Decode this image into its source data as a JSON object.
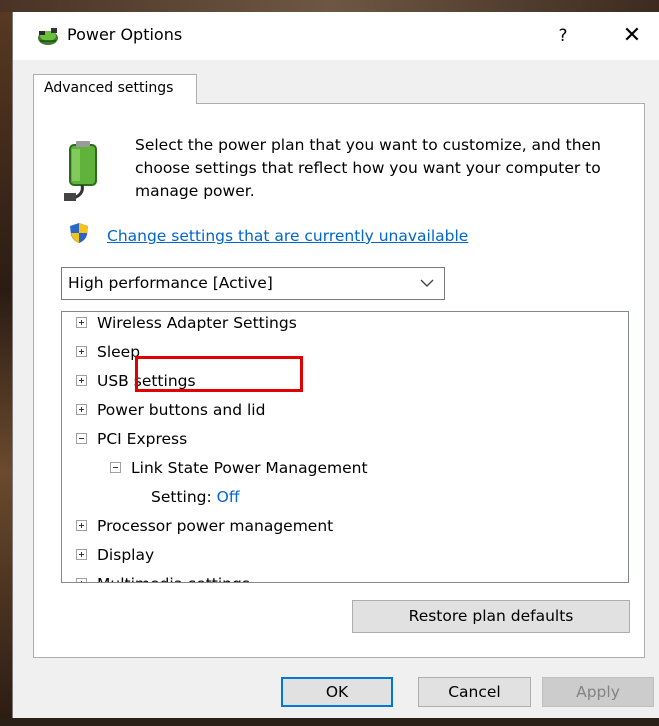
{
  "window": {
    "title": "Power Options",
    "help_label": "?",
    "close_label": "✕",
    "tab_label": "Advanced settings"
  },
  "panel": {
    "description": "Select the power plan that you want to customize, and then choose settings that reflect how you want your computer to manage power.",
    "change_link": "Change settings that are currently unavailable",
    "plan_selected": "High performance [Active]"
  },
  "tree": {
    "items": [
      {
        "label": "Wireless Adapter Settings",
        "expanded": false
      },
      {
        "label": "Sleep",
        "expanded": false
      },
      {
        "label": "USB settings",
        "expanded": false
      },
      {
        "label": "Power buttons and lid",
        "expanded": false
      },
      {
        "label": "PCI Express",
        "expanded": true
      },
      {
        "label": "Link State Power Management",
        "expanded": true
      },
      {
        "label": "Processor power management",
        "expanded": false
      },
      {
        "label": "Display",
        "expanded": false
      },
      {
        "label": "Multimedia settings",
        "expanded": false
      }
    ],
    "setting_label": "Setting:",
    "setting_value": "Off"
  },
  "buttons": {
    "restore": "Restore plan defaults",
    "ok": "OK",
    "cancel": "Cancel",
    "apply": "Apply"
  },
  "colors": {
    "link": "#0066cc",
    "highlight": "#e00000",
    "ok_border": "#0078d7"
  }
}
